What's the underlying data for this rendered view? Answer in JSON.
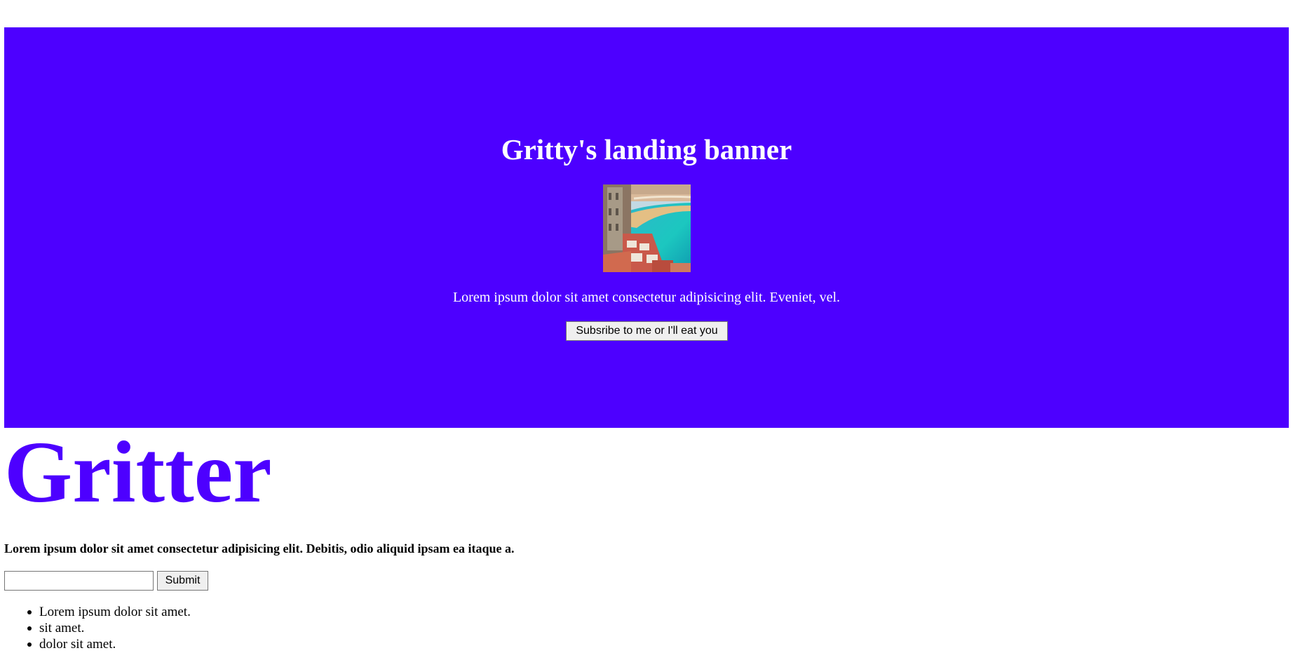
{
  "banner": {
    "title": "Gritty's landing banner",
    "image_icon": "coastal-town-photo",
    "text": "Lorem ipsum dolor sit amet consectetur adipisicing elit. Eveniet, vel.",
    "button_label": "Subsribe to me or I'll eat you",
    "background_color": "#4d00ff"
  },
  "main": {
    "brand": "Gritter",
    "brand_color": "#4d00ff",
    "lead": "Lorem ipsum dolor sit amet consectetur adipisicing elit. Debitis, odio aliquid ipsam ea itaque a.",
    "form": {
      "input_value": "",
      "submit_label": "Submit"
    },
    "list_items": [
      "Lorem ipsum dolor sit amet.",
      "sit amet.",
      "dolor sit amet."
    ]
  }
}
